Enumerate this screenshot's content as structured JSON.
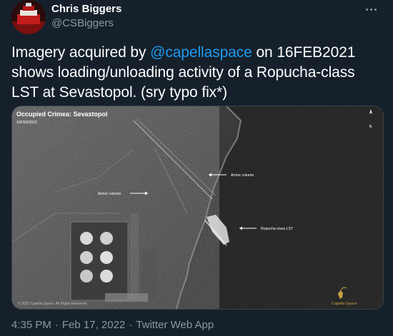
{
  "author": {
    "name": "Chris Biggers",
    "handle": "@CSBiggers"
  },
  "tweet": {
    "text_prefix": "Imagery acquired by ",
    "mention": "@capellaspace",
    "text_suffix": " on 16FEB2021 shows loading/unloading activity of a Ropucha-class LST at Sevastopol. (sry typo fix*)"
  },
  "image": {
    "title": "Occupied Crimea: Sevastopol",
    "date": "16FEB2022",
    "north": "N",
    "label_armor_1": "Armor column",
    "label_armor_2": "Armor column",
    "label_lst": "Ropucha-class LST",
    "copyright": "© 2022 Capella Space. All Rights Reserved.",
    "brand": "Capella Space"
  },
  "footer": {
    "time": "4:35 PM",
    "date": "Feb 17, 2022",
    "source": "Twitter Web App"
  },
  "colors": {
    "background": "#15202b",
    "text": "#ffffff",
    "secondary": "#8b98a5",
    "link": "#1d9bf0"
  }
}
